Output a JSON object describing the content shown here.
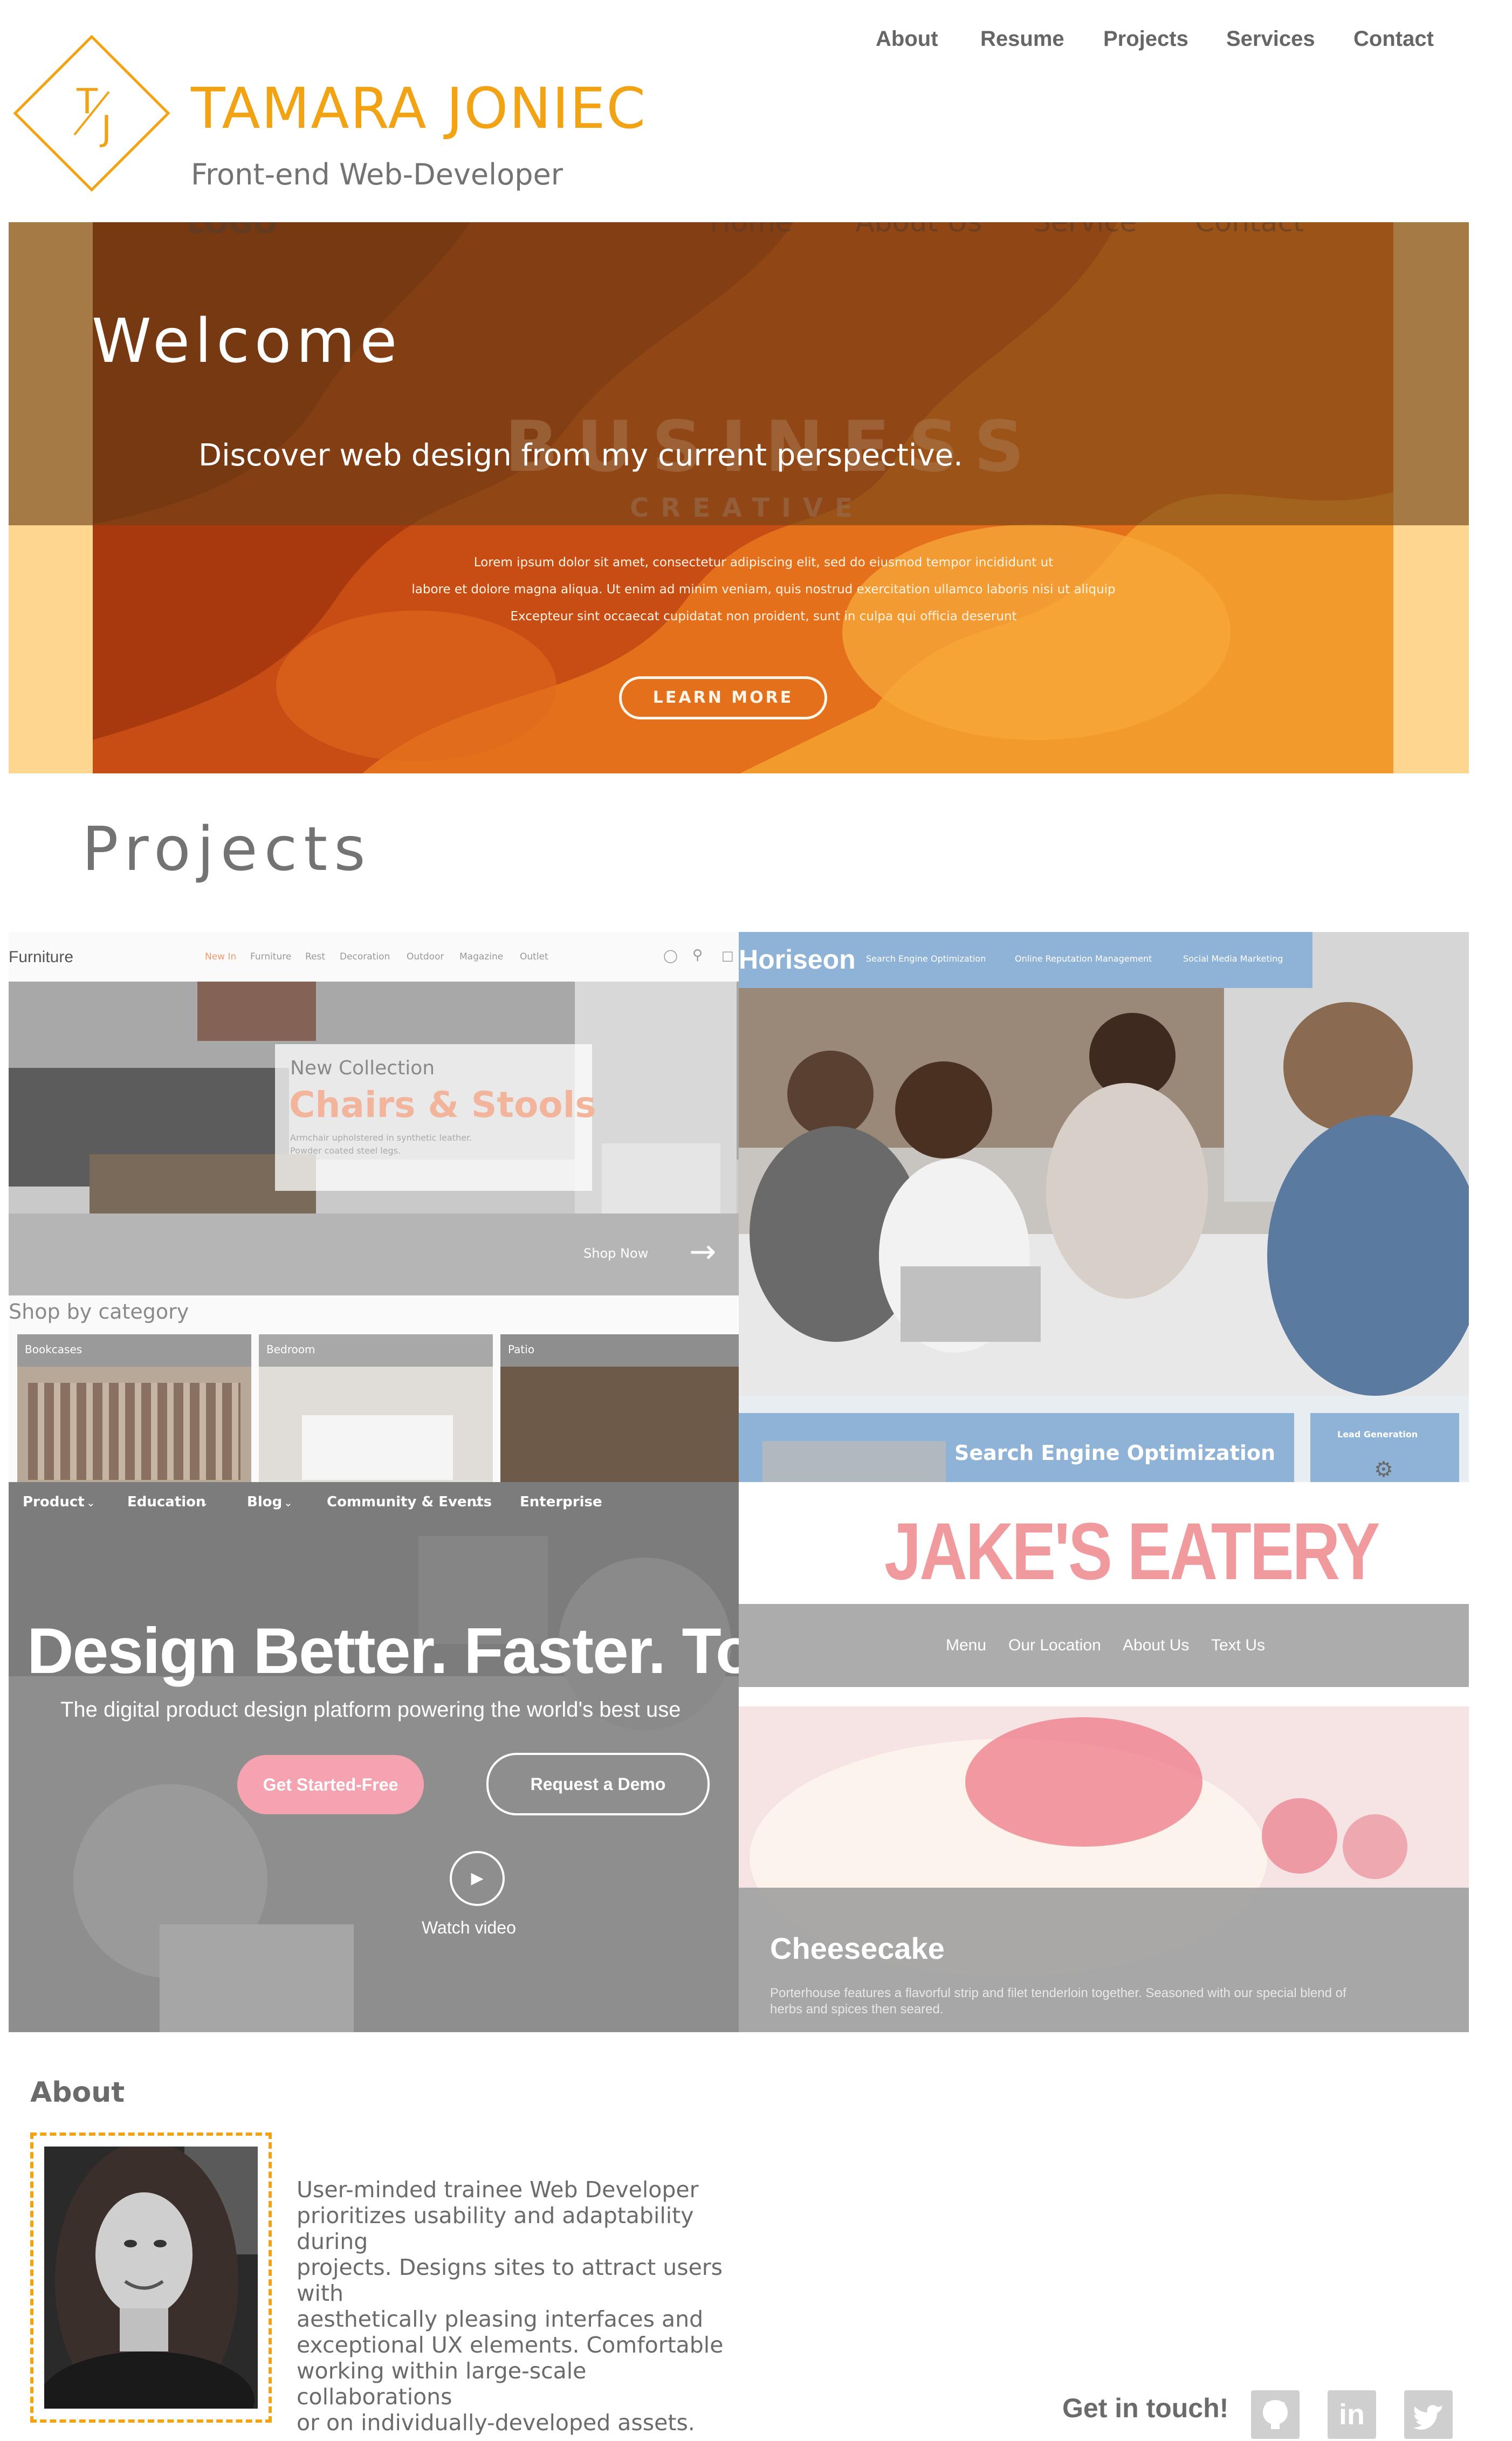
{
  "header": {
    "logo_letters": "T/J",
    "name": "TAMARA JONIEC",
    "subtitle": "Front-end Web-Developer",
    "nav": [
      "About",
      "Resume",
      "Projects",
      "Services",
      "Contact"
    ]
  },
  "hero": {
    "welcome": "Welcome",
    "tagline": "Discover web design from my current perspective.",
    "bg_logo": "LOGO",
    "bg_nav": [
      "Home",
      "About Us",
      "Service",
      "Contact"
    ],
    "bg_headline": "BUSINESS",
    "bg_sub": "CREATIVE",
    "bg_lorem": [
      "Lorem ipsum dolor sit amet, consectetur adipiscing elit, sed do eiusmod tempor incididunt ut",
      "labore et dolore magna aliqua. Ut enim ad minim veniam, quis nostrud exercitation ullamco laboris nisi ut aliquip",
      "Excepteur sint occaecat cupidatat non proident, sunt in culpa qui officia deserunt"
    ],
    "bg_button": "LEARN MORE"
  },
  "projects": {
    "title": "Projects",
    "furniture": {
      "brand": "Furniture",
      "nav": [
        "New In",
        "Furniture",
        "Rest",
        "Decoration",
        "Outdoor",
        "Magazine",
        "Outlet"
      ],
      "eyebrow": "New Collection",
      "headline": "Chairs & Stools",
      "desc_1": "Armchair upholstered in synthetic leather.",
      "desc_2": "Powder coated steel legs.",
      "shop_now": "Shop Now",
      "shop_by": "Shop by category",
      "categories": [
        "Bookcases",
        "Bedroom",
        "Patio"
      ]
    },
    "horiseon": {
      "brand": "Horiseon",
      "nav": [
        "Search Engine Optimization",
        "Online Reputation Management",
        "Social Media Marketing"
      ],
      "panel_title": "Search Engine Optimization",
      "side_title": "Lead Generation"
    },
    "uxpin": {
      "nav": [
        "Product",
        "Education",
        "Blog",
        "Community & Events",
        "Enterprise"
      ],
      "headline": "Design Better. Faster. Tog",
      "sub": "The digital product design platform powering the world's best use",
      "primary": "Get Started-Free",
      "secondary": "Request a Demo",
      "watch": "Watch video"
    },
    "jakes": {
      "title": "JAKE'S EATERY",
      "nav": [
        "Menu",
        "Our Location",
        "About Us",
        "Text Us"
      ],
      "dish": "Cheesecake",
      "desc_1": "Porterhouse features a flavorful strip and filet tenderloin together. Seasoned with our special blend of",
      "desc_2": "herbs and spices then seared."
    }
  },
  "about": {
    "heading": "About",
    "lines": [
      "User-minded trainee Web Developer",
      "prioritizes usability and adaptability during",
      "projects. Designs sites to attract users with",
      "aesthetically pleasing interfaces and",
      "exceptional UX elements. Comfortable",
      "working within large-scale collaborations",
      "or on individually-developed assets."
    ]
  },
  "footer": {
    "cta": "Get in touch!",
    "social": [
      "github-icon",
      "linkedin-icon",
      "twitter-icon"
    ],
    "linkedin_text": "in"
  },
  "colors": {
    "accent": "#f2a313",
    "text": "#6b6b6b"
  }
}
